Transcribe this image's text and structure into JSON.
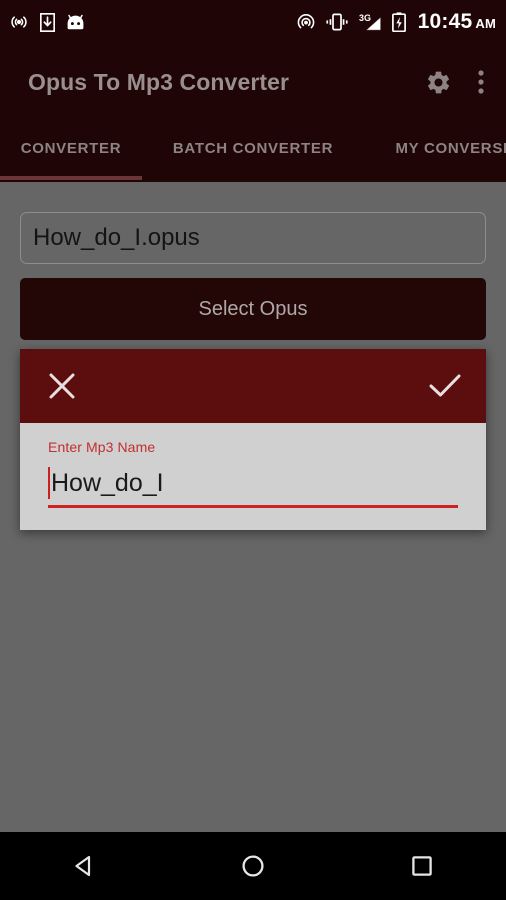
{
  "status_bar": {
    "icons_left": [
      "cast-icon",
      "download-icon",
      "android-head-icon"
    ],
    "icons_right": [
      "hotspot-icon",
      "vibrate-icon",
      "signal-3g-icon",
      "battery-charging-icon"
    ],
    "network_label": "3G",
    "time": "10:45",
    "ampm": "AM"
  },
  "app_bar": {
    "title": "Opus To Mp3 Converter",
    "settings_icon": "gear-icon",
    "overflow_icon": "more-vertical-icon"
  },
  "tabs": {
    "items": [
      {
        "label": "CONVERTER",
        "active": true
      },
      {
        "label": "BATCH CONVERTER",
        "active": false
      },
      {
        "label": "MY CONVERSIONS",
        "active": false
      }
    ],
    "indicator_color": "#6b3535"
  },
  "main": {
    "file_name": "How_do_I.opus",
    "select_button_label": "Select Opus"
  },
  "dialog": {
    "close_icon": "close-icon",
    "confirm_icon": "check-icon",
    "field_label": "Enter Mp3 Name",
    "field_value": "How_do_I",
    "accent_color": "#cc2222",
    "toolbar_color": "#5c0d0d"
  },
  "nav_bar": {
    "back_icon": "back-triangle-icon",
    "home_icon": "home-circle-icon",
    "recents_icon": "recents-square-icon"
  }
}
